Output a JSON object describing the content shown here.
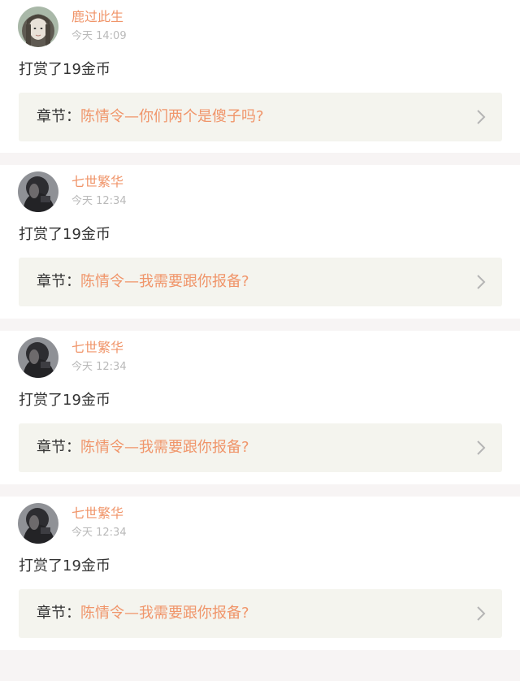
{
  "feed": [
    {
      "avatar_icon": "girl-portrait-avatar-icon",
      "username": "鹿过此生",
      "time": "今天 14:09",
      "action": "打赏了19金币",
      "chapter_label": "章节：",
      "chapter_title": "陈情令—你们两个是傻子吗?",
      "chevron_icon": "chevron-right-icon"
    },
    {
      "avatar_icon": "dark-portrait-avatar-icon",
      "username": "七世繁华",
      "time": "今天 12:34",
      "action": "打赏了19金币",
      "chapter_label": "章节：",
      "chapter_title": "陈情令—我需要跟你报备?",
      "chevron_icon": "chevron-right-icon"
    },
    {
      "avatar_icon": "dark-portrait-avatar-icon",
      "username": "七世繁华",
      "time": "今天 12:34",
      "action": "打赏了19金币",
      "chapter_label": "章节：",
      "chapter_title": "陈情令—我需要跟你报备?",
      "chevron_icon": "chevron-right-icon"
    },
    {
      "avatar_icon": "dark-portrait-avatar-icon",
      "username": "七世繁华",
      "time": "今天 12:34",
      "action": "打赏了19金币",
      "chapter_label": "章节：",
      "chapter_title": "陈情令—我需要跟你报备?",
      "chevron_icon": "chevron-right-icon"
    }
  ],
  "colors": {
    "accent": "#f0956a",
    "text": "#333333",
    "muted": "#b9b9b9",
    "chapter_bg": "#f4f4ee",
    "divider": "#f7f4f4"
  }
}
